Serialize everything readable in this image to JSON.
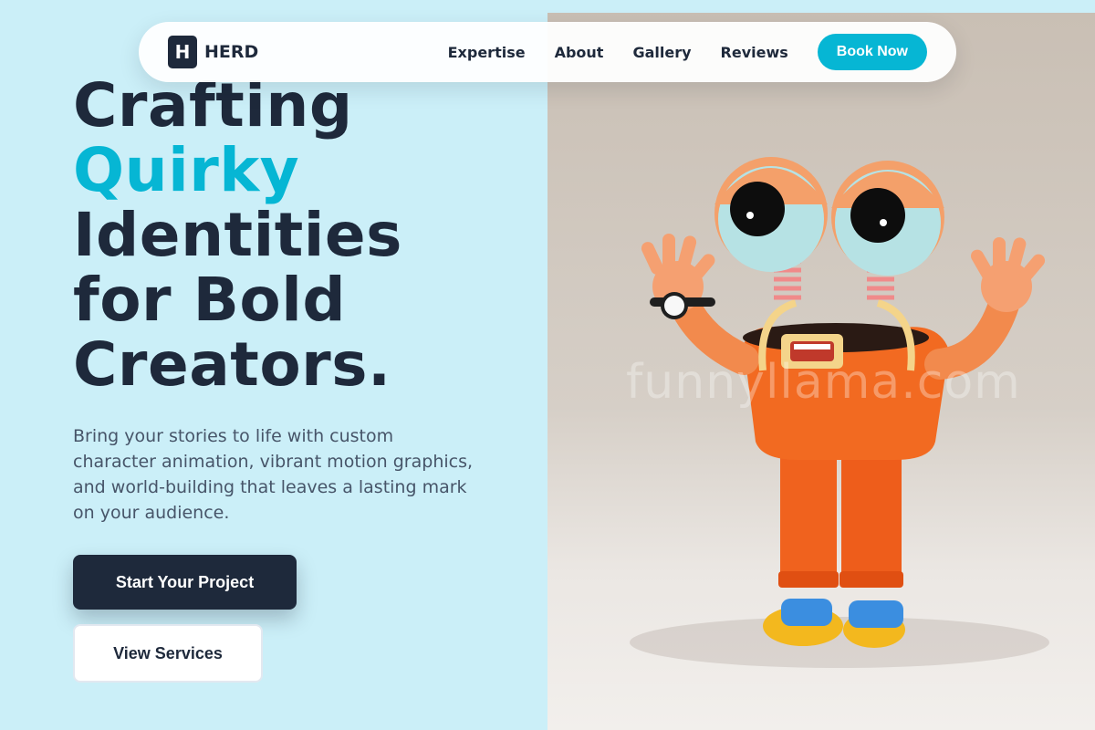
{
  "nav": {
    "logo_letter": "H",
    "logo_text": "HERD",
    "links": [
      "Expertise",
      "About",
      "Gallery",
      "Reviews"
    ],
    "cta_label": "Book Now"
  },
  "hero": {
    "headline_line1": "Crafting",
    "headline_accent": "Quirky",
    "headline_line3": "Identities",
    "headline_line4": "for Bold",
    "headline_line5": "Creators.",
    "subtext": "Bring your stories to life with custom character animation, vibrant motion graphics, and world-building that leaves a lasting mark on your audience.",
    "primary_button": "Start Your Project",
    "secondary_button": "View Services"
  },
  "image": {
    "watermark": "funnyllama.com"
  },
  "colors": {
    "background": "#cbeff8",
    "accent": "#06b6d4",
    "dark": "#1e293b"
  }
}
